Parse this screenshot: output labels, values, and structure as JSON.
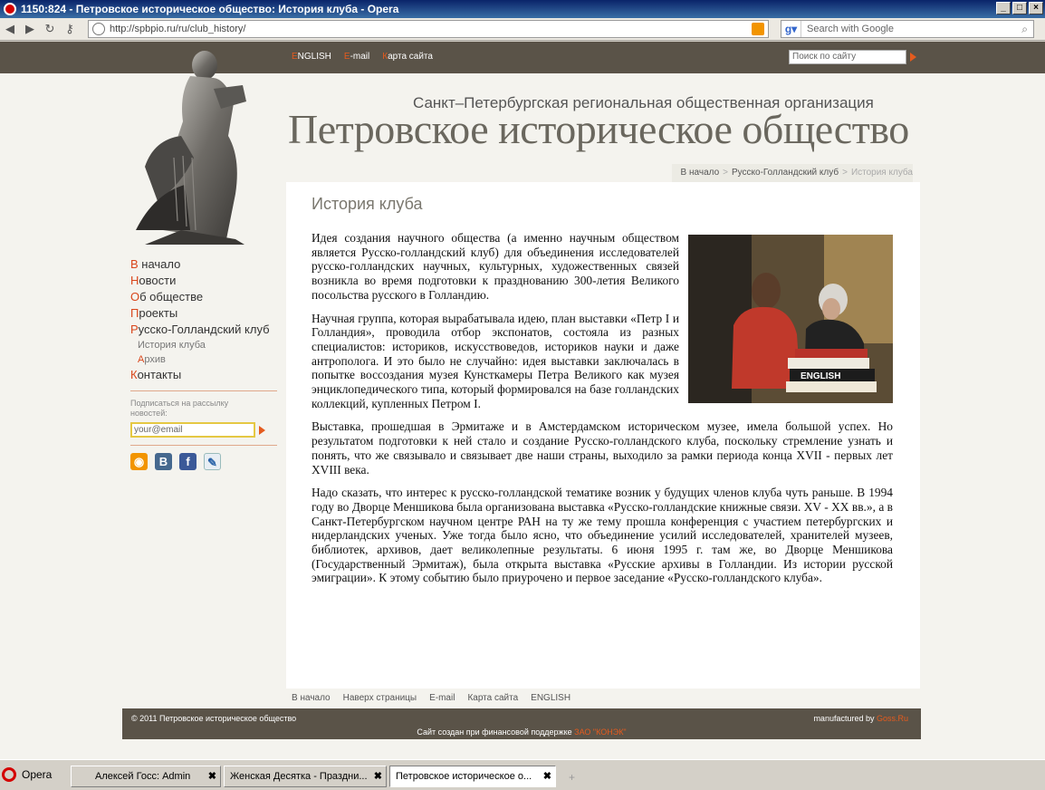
{
  "window": {
    "title": "1150:824 - Петровское историческое общество: История клуба - Opera"
  },
  "browser": {
    "url": "http://spbpio.ru/ru/club_history/",
    "search_engine_placeholder": "Search with Google"
  },
  "header": {
    "links": [
      {
        "accent": "E",
        "rest": "NGLISH"
      },
      {
        "accent": "E",
        "rest": "-mail"
      },
      {
        "accent": "К",
        "rest": "арта сайта"
      }
    ],
    "search_placeholder": "Поиск  по сайту",
    "org_subtitle": "Санкт–Петербургская региональная общественная организация",
    "org_title": "Петровское историческое общество"
  },
  "menu": {
    "items": [
      {
        "accent": "В",
        "rest": " начало"
      },
      {
        "accent": "Н",
        "rest": "овости"
      },
      {
        "accent": "О",
        "rest": "б обществе"
      },
      {
        "accent": "П",
        "rest": "роекты"
      },
      {
        "accent": "Р",
        "rest": "усско-Голландский клуб"
      }
    ],
    "subitems": [
      {
        "accent": "",
        "rest": "История клуба"
      },
      {
        "accent": "А",
        "rest": "рхив"
      }
    ],
    "last": {
      "accent": "К",
      "rest": "онтакты"
    },
    "subscribe_label": "Подписаться на рассылку новостей:",
    "email_placeholder": "your@email"
  },
  "breadcrumb": {
    "home": "В начало",
    "section": "Русско-Голландский клуб",
    "current": "История клуба"
  },
  "page": {
    "title": "История клуба",
    "paragraphs": [
      "Идея создания научного общества (а именно научным обществом является Русско-голландский клуб) для объединения исследователей русско-голландских научных, культурных, художественных связей возникла во время подготовки к празднованию 300-летия Великого посольства русского в Голландию.",
      "Научная группа, которая вырабатывала идею, план выставки «Петр I и Голландия», проводила отбор экспонатов, состояла из разных специалистов: историков, искусствоведов, историков науки и даже антрополога. И это было не случайно: идея выставки заключалась в попытке воссоздания музея Кунсткамеры Петра Великого как музея энциклопедического типа, который формировался на базе голландских коллекций, купленных Петром I.",
      "Выставка, прошедшая в Эрмитаже и в Амстердамском историческом музее, имела большой успех. Но результатом подготовки к ней стало и создание Русско-голландского клуба, поскольку стремление узнать и понять, что же связывало и связывает две наши страны, выходило за рамки периода конца XVII - первых лет XVIII века.",
      "Надо сказать, что интерес к русско-голландской тематике возник у будущих членов клуба чуть раньше. В 1994 году во Дворце Меншикова была организована выставка «Русско-голландские книжные связи. XV - XX вв.», а в Санкт-Петербургском научном центре РАН на ту же тему прошла конференция с участием петербургских и нидерландских ученых. Уже тогда было ясно, что объединение усилий исследователей, хранителей музеев, библиотек, архивов, дает великолепные результаты. 6 июня 1995 г. там же, во Дворце Меншикова (Государственный Эрмитаж), была открыта выставка «Русские архивы в Голландии. Из истории русской эмиграции». К этому событию было приурочено и первое заседание «Русско-голландского клуба»."
    ],
    "photo_book_text": "ENGLISH"
  },
  "footer": {
    "links": [
      "В начало",
      "Наверх страницы",
      "E-mail",
      "Карта сайта",
      "ENGLISH"
    ],
    "copyright": "© 2011 Петровское историческое общество",
    "manufactured_prefix": "manufactured by ",
    "manufactured_link": "Goss.Ru",
    "support_prefix": "Сайт создан при финансовой поддержке ",
    "support_link": "ЗАО \"КОНЭК\""
  },
  "taskbar": {
    "start": "Opera",
    "tasks": [
      "Алексей Госс: Admin",
      "Женская Десятка - Праздни...",
      "Петровское историческое о..."
    ]
  },
  "colors": {
    "accent": "#e45b1e",
    "band": "#5a5348"
  }
}
